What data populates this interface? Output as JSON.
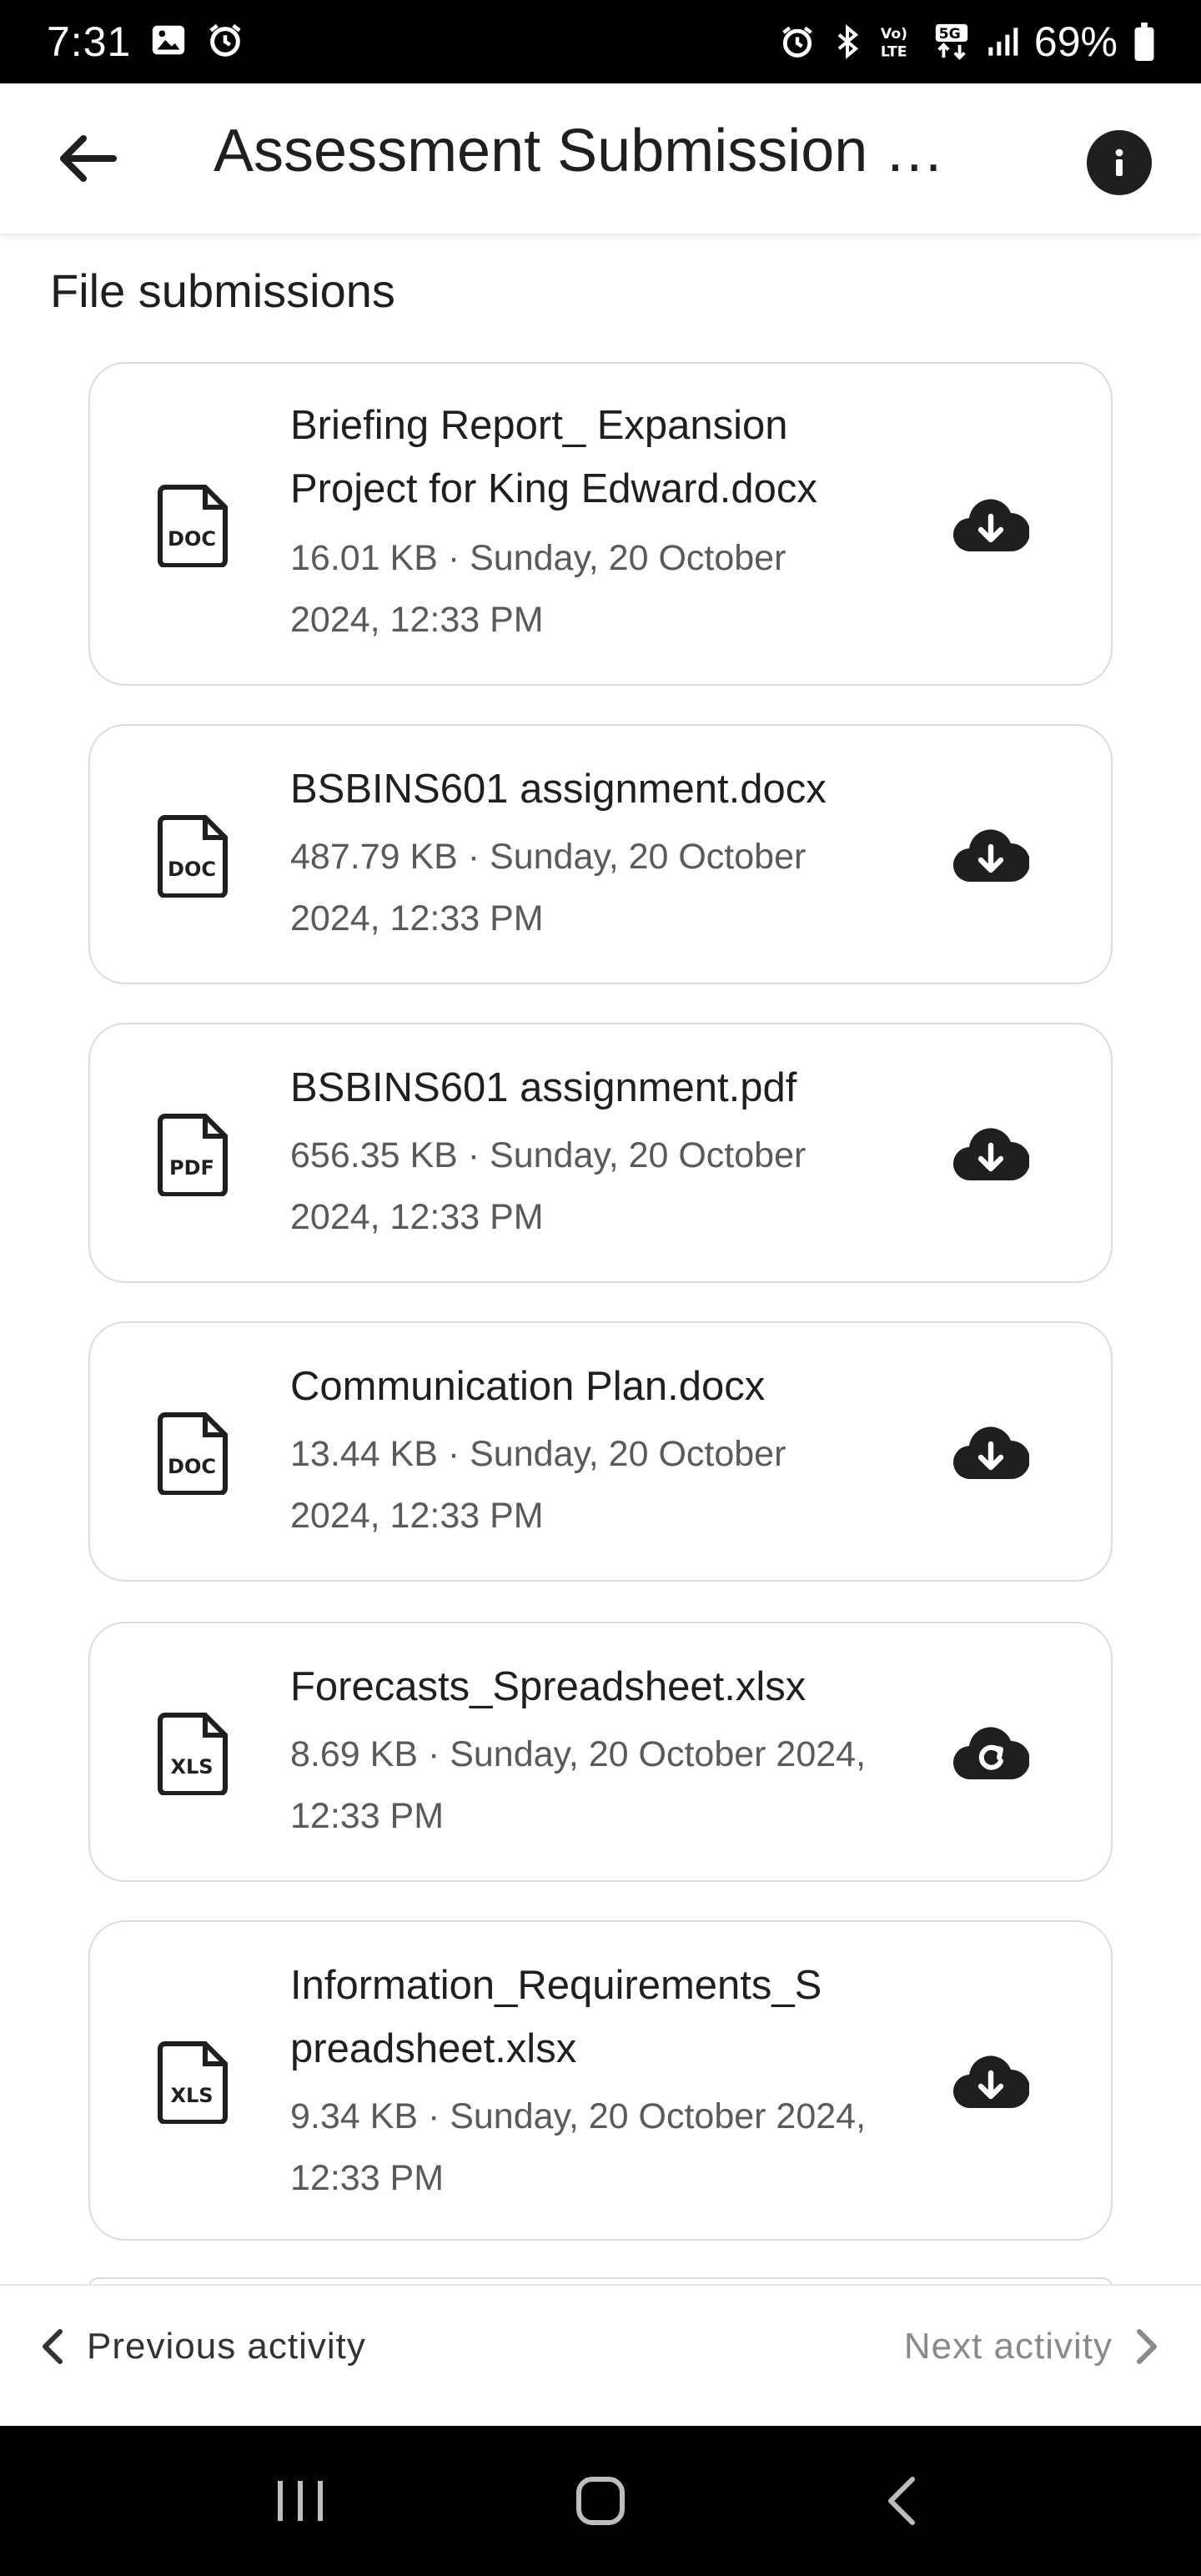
{
  "status_bar": {
    "time": "7:31",
    "battery_percent": "69%",
    "network": "5G"
  },
  "app_bar": {
    "title": "Assessment Submission …"
  },
  "section": {
    "title": "File submissions"
  },
  "files": [
    {
      "name_line1": "Briefing Report_ Expansion",
      "name_line2": "Project for King Edward.docx",
      "meta_line1": "16.01 KB · Sunday, 20 October",
      "meta_line2": "2024, 12:33 PM",
      "type": "DOC",
      "action_icon": "cloud-download-icon"
    },
    {
      "name_line1": "BSBINS601 assignment.docx",
      "meta_line1": "487.79 KB · Sunday, 20 October",
      "meta_line2": "2024, 12:33 PM",
      "type": "DOC",
      "action_icon": "cloud-download-icon"
    },
    {
      "name_line1": "BSBINS601 assignment.pdf",
      "meta_line1": "656.35 KB · Sunday, 20 October",
      "meta_line2": "2024, 12:33 PM",
      "type": "PDF",
      "action_icon": "cloud-download-icon"
    },
    {
      "name_line1": "Communication Plan.docx",
      "meta_line1": "13.44 KB · Sunday, 20 October",
      "meta_line2": "2024, 12:33 PM",
      "type": "DOC",
      "action_icon": "cloud-download-icon"
    },
    {
      "name_line1": "Forecasts_Spreadsheet.xlsx",
      "meta_line1": "8.69 KB · Sunday, 20 October 2024,",
      "meta_line2": "12:33 PM",
      "type": "XLS",
      "action_icon": "cloud-sync-icon"
    },
    {
      "name_line1": "Information_Requirements_S",
      "name_line2": "preadsheet.xlsx",
      "meta_line1": "9.34 KB · Sunday, 20 October 2024,",
      "meta_line2": "12:33 PM",
      "type": "XLS",
      "action_icon": "cloud-download-icon"
    }
  ],
  "activity_nav": {
    "previous_label": "Previous activity",
    "next_label": "Next activity"
  },
  "colors": {
    "text_primary": "#1f1f1f",
    "text_secondary": "#5a5a5a",
    "card_border": "#dcdcdc",
    "disabled": "#8a8a8a"
  }
}
